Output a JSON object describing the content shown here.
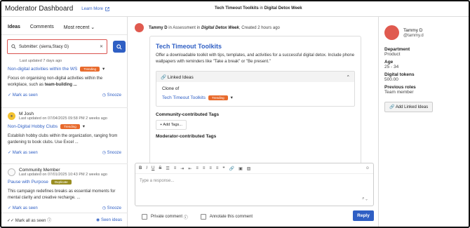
{
  "header": {
    "title": "Moderator Dashboard",
    "learn_more": "Learn More",
    "context_title": "Tech Timeout Toolkits",
    "context_in": "in",
    "context_group": "Digital Detox Week"
  },
  "left": {
    "tabs": [
      "Ideas",
      "Comments",
      "Most recent"
    ],
    "search_value": "Submitter: (sierra,Stacy G)",
    "items": [
      {
        "meta": "Last updated 7 days ago",
        "title": "Non-digital activities within the WS",
        "badge": "Trending",
        "desc": "Focus on organising non-digital activities within the workplace, such as ",
        "desc_bold": "team-building ...",
        "mark": "Mark as seen",
        "snooze": "Snooze"
      },
      {
        "author": "M Josh",
        "meta": "Last updated on 07/04/2025 09:58 PM 2 weeks ago",
        "title": "Non-Digital Hobby Clubs",
        "badge": "Trending",
        "desc": "Establish hobby clubs within the organization, ranging from gardening to book clubs. Use Excel ...",
        "mark": "Mark as seen",
        "snooze": "Snooze"
      },
      {
        "author": "Community Member",
        "meta": "Last updated on 07/01/2025 10:43 PM 2 weeks ago",
        "title": "Pause with Purpose",
        "badge": "Duplicate",
        "desc": "This campaign redefines breaks as essential moments for mental clarity and creative recharge. ...",
        "mark": "Mark as seen",
        "snooze": "Snooze"
      }
    ],
    "footer": {
      "mark_all": "Mark all as seen",
      "seen_ideas": "Seen ideas"
    }
  },
  "main": {
    "author": "Tammy D",
    "action_text": "in Assessment in",
    "group": "Digital Detox Week",
    "created": ", Created 2 hours ago",
    "idea_title": "Tech Timeout Toolkits",
    "idea_desc": "Offer a downloadable toolkit with tips, templates, and activities for a successful digital detox. Include phone wallpapers with reminders like \"Take a break\" or \"Be present.\"",
    "linked_ideas": "Linked Ideas",
    "clone_of": "Clone of",
    "clone_title": "Tech Timeout Toolkits",
    "clone_badge": "Trending",
    "community_tags": "Community-contributed Tags",
    "add_tags": "+ Add Tags...",
    "moderator_tags": "Moderator-contributed Tags",
    "placeholder": "Type a response...",
    "private_comment": "Private comment",
    "annotate": "Annotate this comment",
    "reply": "Reply"
  },
  "right": {
    "name": "Tammy D",
    "handle": "@tammy.d",
    "fields": [
      {
        "label": "Department",
        "value": "Product"
      },
      {
        "label": "Age",
        "value": "25 - 34"
      },
      {
        "label": "Digital tokens",
        "value": "500.00"
      },
      {
        "label": "Previous roles",
        "value": "Team member"
      }
    ],
    "add_linked": "Add Linked Ideas"
  },
  "colors": {
    "accent": "#2f5fc4",
    "trending": "#e86a2c",
    "duplicate": "#9a8e22",
    "search_border": "#d9534f"
  }
}
